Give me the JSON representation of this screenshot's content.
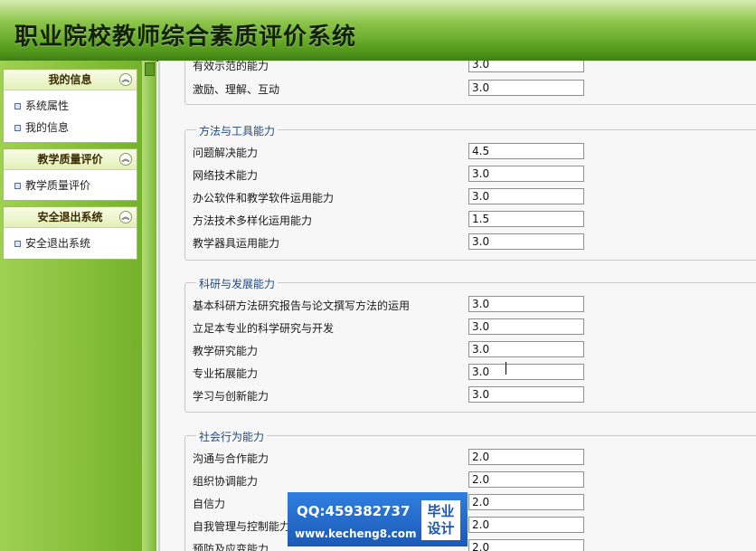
{
  "header": {
    "title": "职业院校教师综合素质评价系统"
  },
  "sidebar": {
    "groups": [
      {
        "title": "我的信息",
        "items": [
          "系统属性",
          "我的信息"
        ]
      },
      {
        "title": "教学质量评价",
        "items": [
          "教学质量评价"
        ]
      },
      {
        "title": "安全退出系统",
        "items": [
          "安全退出系统"
        ]
      }
    ]
  },
  "sections": [
    {
      "legend": "",
      "rows": [
        {
          "label": "有效示范的能力",
          "value": "3.0"
        },
        {
          "label": "激励、理解、互动",
          "value": "3.0"
        }
      ]
    },
    {
      "legend": "方法与工具能力",
      "rows": [
        {
          "label": "问题解决能力",
          "value": "4.5"
        },
        {
          "label": "网络技术能力",
          "value": "3.0"
        },
        {
          "label": "办公软件和教学软件运用能力",
          "value": "3.0"
        },
        {
          "label": "方法技术多样化运用能力",
          "value": "1.5"
        },
        {
          "label": "教学器具运用能力",
          "value": "3.0"
        }
      ]
    },
    {
      "legend": "科研与发展能力",
      "rows": [
        {
          "label": "基本科研方法研究报告与论文撰写方法的运用",
          "value": "3.0"
        },
        {
          "label": "立足本专业的科学研究与开发",
          "value": "3.0"
        },
        {
          "label": "教学研究能力",
          "value": "3.0"
        },
        {
          "label": "专业拓展能力",
          "value": "3.0"
        },
        {
          "label": "学习与创新能力",
          "value": "3.0"
        }
      ]
    },
    {
      "legend": "社会行为能力",
      "rows": [
        {
          "label": "沟通与合作能力",
          "value": "2.0"
        },
        {
          "label": "组织协调能力",
          "value": "2.0"
        },
        {
          "label": "自信力",
          "value": "2.0"
        },
        {
          "label": "自我管理与控制能力",
          "value": "2.0"
        },
        {
          "label": "预防及应变能力",
          "value": "2.0"
        }
      ]
    }
  ],
  "watermark": {
    "qq": "QQ:459382737",
    "url": "www.kecheng8.com",
    "badge_line1": "毕业",
    "badge_line2": "设计"
  }
}
